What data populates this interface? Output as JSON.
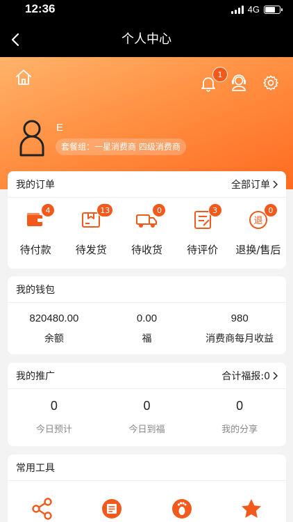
{
  "status_bar": {
    "time": "12:36",
    "network": "4G"
  },
  "nav": {
    "title": "个人中心"
  },
  "header": {
    "notification_count": "1",
    "username": "E",
    "plan": "套餐组：一星消费商 四级消费商"
  },
  "orders": {
    "title": "我的订单",
    "all_label": "全部订单",
    "items": [
      {
        "label": "待付款",
        "count": "4",
        "icon": "wallet-icon"
      },
      {
        "label": "待发货",
        "count": "13",
        "icon": "package-icon"
      },
      {
        "label": "待收货",
        "count": "0",
        "icon": "truck-icon"
      },
      {
        "label": "待评价",
        "count": "3",
        "icon": "review-icon"
      },
      {
        "label": "退换/售后",
        "count": "0",
        "icon": "refund-icon"
      }
    ]
  },
  "wallet": {
    "title": "我的钱包",
    "items": [
      {
        "value": "820480.00",
        "label": "余额"
      },
      {
        "value": "0.00",
        "label": "福"
      },
      {
        "value": "980",
        "label": "消费商每月收益"
      }
    ]
  },
  "promotion": {
    "title": "我的推广",
    "total_label": "合计福报:0",
    "items": [
      {
        "value": "0",
        "label": "今日预计"
      },
      {
        "value": "0",
        "label": "今日到福"
      },
      {
        "value": "0",
        "label": "我的分享"
      }
    ]
  },
  "tools": {
    "title": "常用工具",
    "icons": [
      "share-icon",
      "document-icon",
      "footprint-icon",
      "star-icon"
    ]
  },
  "colors": {
    "accent": "#f25a1c",
    "gradient_start": "#ffb36b",
    "gradient_end": "#ff6a1f"
  }
}
